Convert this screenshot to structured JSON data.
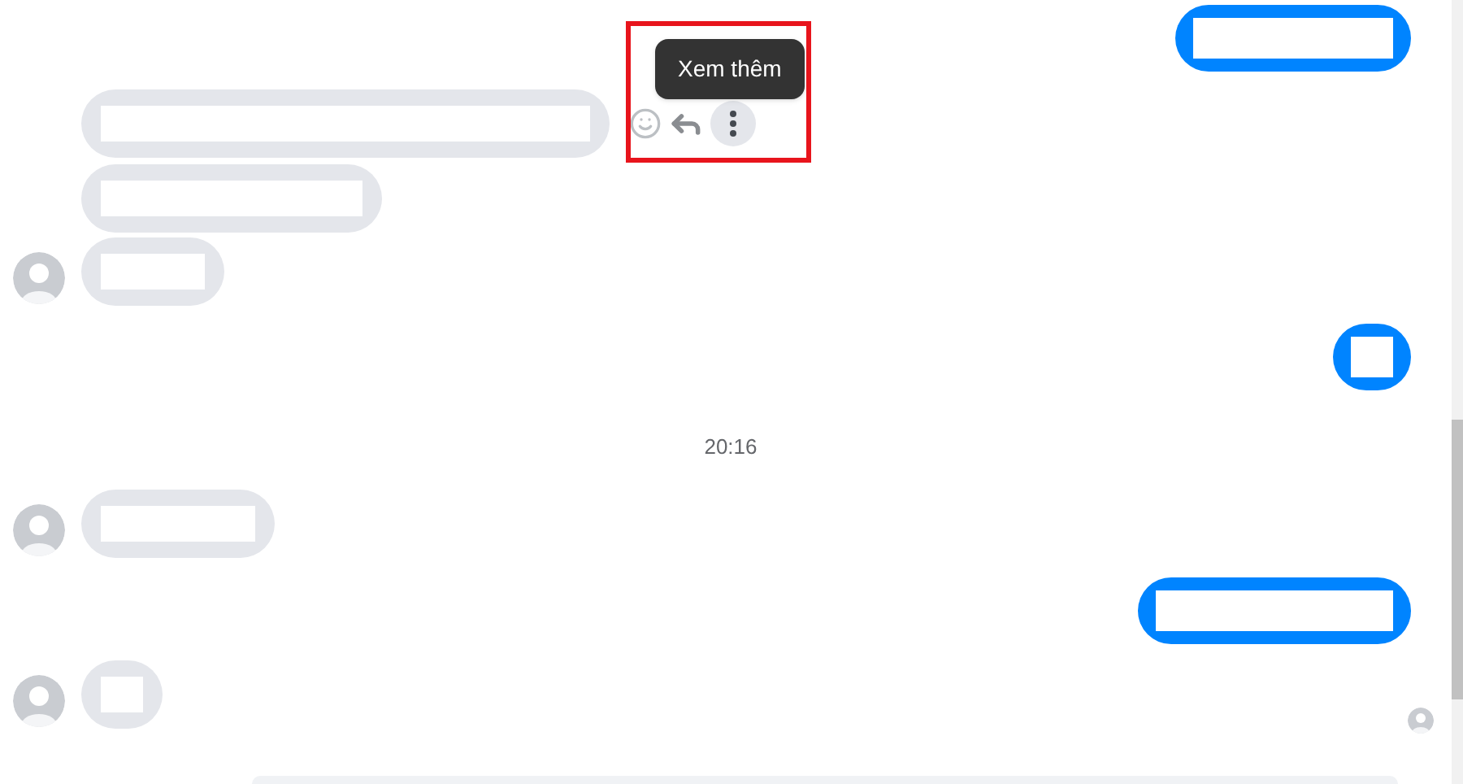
{
  "messages": [
    {
      "kind": "outgoing"
    },
    {
      "kind": "incoming",
      "avatar": false,
      "hover_actions": true,
      "tooltip": "Xem thêm"
    },
    {
      "kind": "incoming",
      "avatar": false
    },
    {
      "kind": "incoming",
      "avatar": true
    },
    {
      "kind": "outgoing"
    },
    {
      "kind": "timestamp",
      "text": "20:16"
    },
    {
      "kind": "incoming",
      "avatar": true
    },
    {
      "kind": "outgoing"
    },
    {
      "kind": "incoming",
      "avatar": true,
      "seen": true
    }
  ]
}
